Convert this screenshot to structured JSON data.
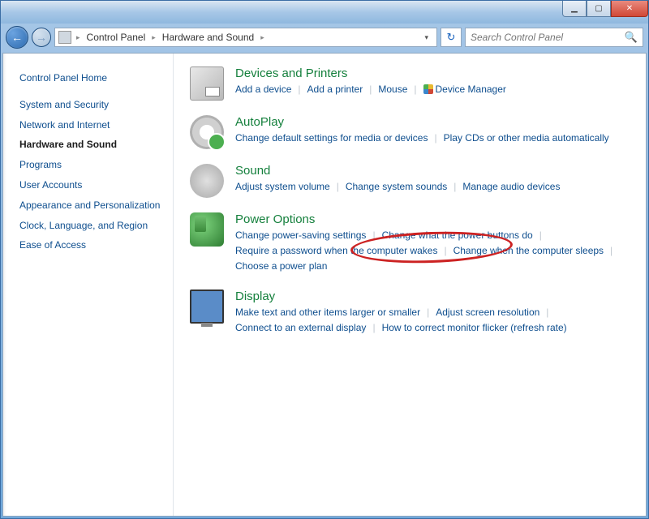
{
  "breadcrumb": {
    "root": "Control Panel",
    "current": "Hardware and Sound"
  },
  "search": {
    "placeholder": "Search Control Panel"
  },
  "sidebar": {
    "home": "Control Panel Home",
    "items": [
      "System and Security",
      "Network and Internet",
      "Hardware and Sound",
      "Programs",
      "User Accounts",
      "Appearance and Personalization",
      "Clock, Language, and Region",
      "Ease of Access"
    ],
    "active_index": 2
  },
  "categories": [
    {
      "title": "Devices and Printers",
      "icon": "devices",
      "links": [
        "Add a device",
        "Add a printer",
        "Mouse",
        "Device Manager"
      ],
      "shield_indexes": [
        3
      ]
    },
    {
      "title": "AutoPlay",
      "icon": "autoplay",
      "links": [
        "Change default settings for media or devices",
        "Play CDs or other media automatically"
      ]
    },
    {
      "title": "Sound",
      "icon": "sound",
      "links": [
        "Adjust system volume",
        "Change system sounds",
        "Manage audio devices"
      ]
    },
    {
      "title": "Power Options",
      "icon": "power",
      "links": [
        "Change power-saving settings",
        "Change what the power buttons do",
        "Require a password when the computer wakes",
        "Change when the computer sleeps",
        "Choose a power plan"
      ]
    },
    {
      "title": "Display",
      "icon": "display",
      "links": [
        "Make text and other items larger or smaller",
        "Adjust screen resolution",
        "Connect to an external display",
        "How to correct monitor flicker (refresh rate)"
      ]
    }
  ],
  "annotation": {
    "highlighted_category": "Power Options"
  }
}
